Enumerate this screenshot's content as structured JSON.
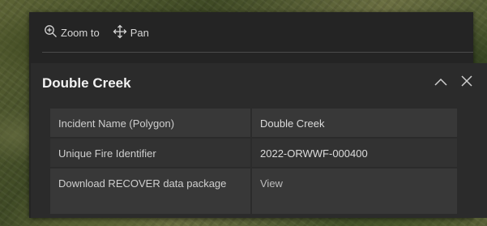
{
  "actions": {
    "zoom_label": "Zoom to",
    "pan_label": "Pan",
    "zoom_icon": "zoom-in-magnifier",
    "pan_icon": "four-way-arrows"
  },
  "feature": {
    "title": "Double Creek",
    "collapse_icon": "chevron-up",
    "close_icon": "x"
  },
  "attributes": [
    {
      "label": "Incident Name (Polygon)",
      "value": "Double Creek"
    },
    {
      "label": "Unique Fire Identifier",
      "value": "2022-ORWWF-000400"
    },
    {
      "label": "Download RECOVER data package",
      "value": "View"
    }
  ],
  "colors": {
    "popup_bg": "#242424",
    "panel_bg": "#2b2b2b",
    "text": "#f2f2f2"
  }
}
